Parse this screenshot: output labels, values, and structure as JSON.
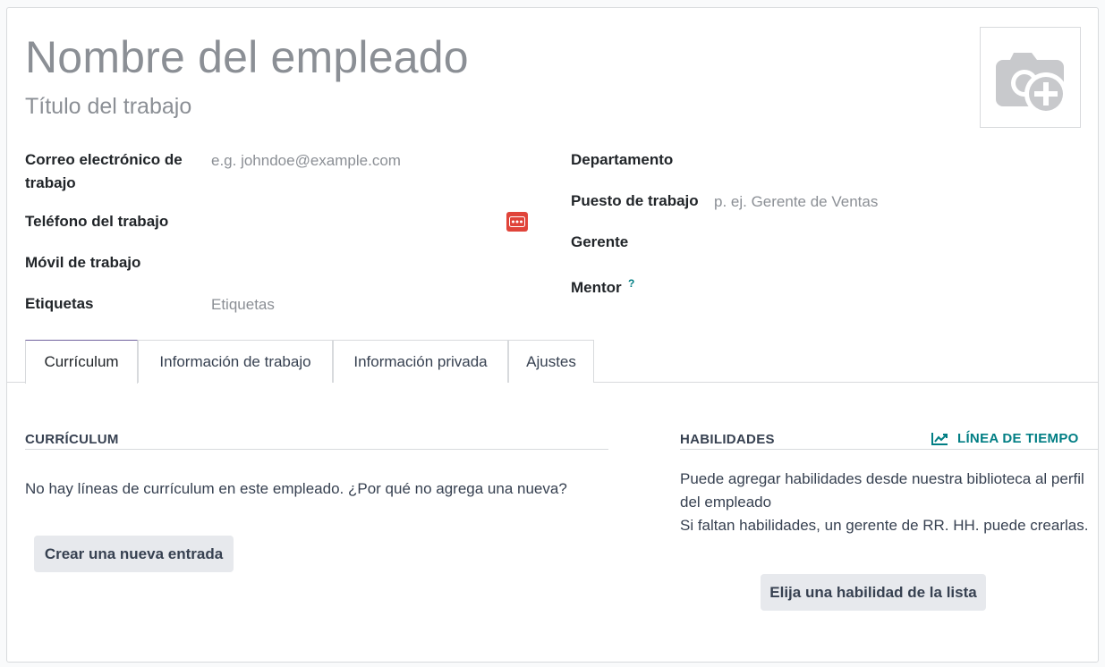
{
  "header": {
    "employee_name_placeholder": "Nombre del empleado",
    "job_title_placeholder": "Título del trabajo"
  },
  "left_fields": {
    "work_email_label_line1": "Correo electrónico de",
    "work_email_label_line2": "trabajo",
    "work_email_placeholder": "e.g. johndoe@example.com",
    "work_phone_label": "Teléfono del trabajo",
    "work_mobile_label": "Móvil de trabajo",
    "tags_label": "Etiquetas",
    "tags_placeholder": "Etiquetas"
  },
  "right_fields": {
    "department_label": "Departamento",
    "job_position_label": "Puesto de trabajo",
    "job_position_placeholder": "p. ej. Gerente de Ventas",
    "manager_label": "Gerente",
    "coach_label": "Mentor",
    "coach_help": "?"
  },
  "tabs": [
    {
      "label": "Currículum",
      "active": true
    },
    {
      "label": "Información de trabajo",
      "active": false
    },
    {
      "label": "Información privada",
      "active": false
    },
    {
      "label": "Ajustes",
      "active": false
    }
  ],
  "resume": {
    "title": "CURRÍCULUM",
    "empty_text": "No hay líneas de currículum en este empleado. ¿Por qué no agrega una nueva?",
    "create_button": "Crear una nueva entrada"
  },
  "skills": {
    "title": "HABILIDADES",
    "timeline_link": "LÍNEA DE TIEMPO",
    "text_line1": "Puede agregar habilidades desde nuestra biblioteca al perfil",
    "text_line2": "del empleado",
    "text_line3": "Si faltan habilidades, un gerente de RR. HH. puede crearlas.",
    "pick_button": "Elija una habilidad de la lista"
  },
  "colors": {
    "accent": "#017e84",
    "tab_active": "#71639e",
    "phone_button": "#e0443a",
    "placeholder": "#8b8f95"
  },
  "icons": {
    "avatar": "camera-plus-icon",
    "phone_action": "dots-icon",
    "timeline": "line-chart-icon"
  }
}
